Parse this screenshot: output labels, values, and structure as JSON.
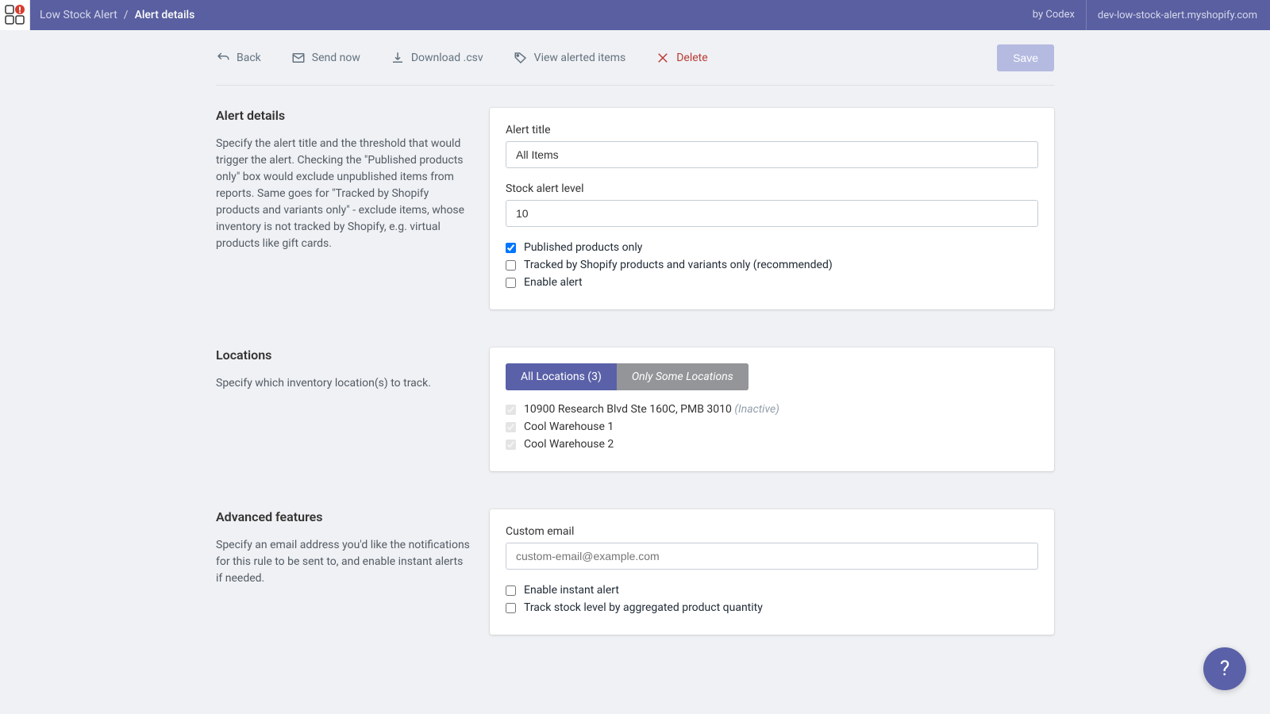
{
  "topbar": {
    "breadcrumb_root": "Low Stock Alert",
    "breadcrumb_current": "Alert details",
    "by": "by Codex",
    "domain": "dev-low-stock-alert.myshopify.com"
  },
  "actions": {
    "back": "Back",
    "send": "Send now",
    "download": "Download .csv",
    "view": "View alerted items",
    "delete": "Delete",
    "save": "Save"
  },
  "sections": {
    "details": {
      "title": "Alert details",
      "desc": "Specify the alert title and the threshold that would trigger the alert. Checking the \"Published products only\" box would exclude unpublished items from reports. Same goes for \"Tracked by Shopify products and variants only\" - exclude items, whose inventory is not tracked by Shopify, e.g. virtual products like gift cards.",
      "alert_title_label": "Alert title",
      "alert_title_value": "All Items",
      "level_label": "Stock alert level",
      "level_value": "10",
      "cb_published": "Published products only",
      "cb_tracked": "Tracked by Shopify products and variants only (recommended)",
      "cb_enable": "Enable alert"
    },
    "locations": {
      "title": "Locations",
      "desc": "Specify which inventory location(s) to track.",
      "tab_all": "All Locations (3)",
      "tab_some": "Only Some Locations",
      "loc1": "10900 Research Blvd Ste 160C, PMB 3010",
      "loc1_inactive": "(Inactive)",
      "loc2": "Cool Warehouse 1",
      "loc3": "Cool Warehouse 2"
    },
    "advanced": {
      "title": "Advanced features",
      "desc": "Specify an email address you'd like the notifications for this rule to be sent to, and enable instant alerts if needed.",
      "email_label": "Custom email",
      "email_placeholder": "custom-email@example.com",
      "cb_instant": "Enable instant alert",
      "cb_aggregate": "Track stock level by aggregated product quantity"
    }
  },
  "help": "?"
}
